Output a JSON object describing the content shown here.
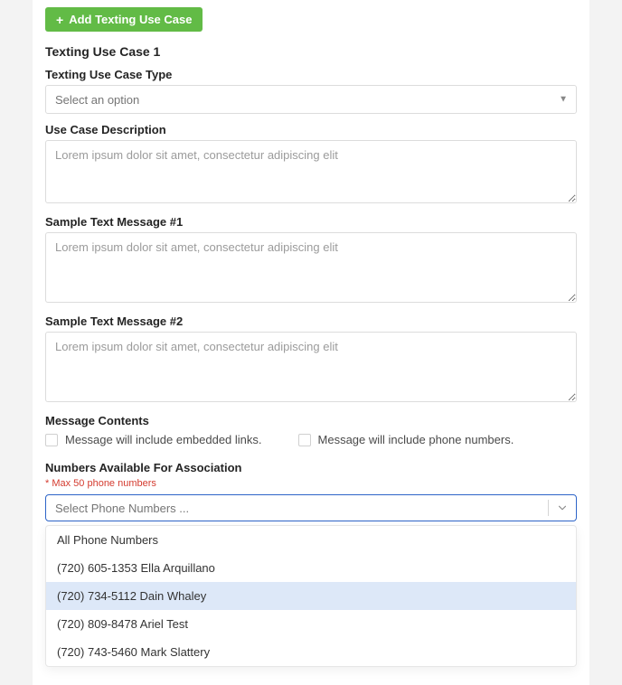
{
  "addButton": {
    "label": "Add Texting Use Case"
  },
  "heading": "Texting Use Case 1",
  "fields": {
    "typeLabel": "Texting Use Case Type",
    "typePlaceholder": "Select an option",
    "descLabel": "Use Case Description",
    "descPlaceholder": "Lorem ipsum dolor sit amet, consectetur adipiscing elit",
    "sample1Label": "Sample Text Message #1",
    "sample1Placeholder": "Lorem ipsum dolor sit amet, consectetur adipiscing elit",
    "sample2Label": "Sample Text Message #2",
    "sample2Placeholder": "Lorem ipsum dolor sit amet, consectetur adipiscing elit"
  },
  "messageContents": {
    "heading": "Message Contents",
    "opt1": "Message will include embedded links.",
    "opt2": "Message will include phone numbers."
  },
  "assoc": {
    "heading": "Numbers Available For Association",
    "note": "* Max 50 phone numbers",
    "placeholder": "Select Phone Numbers ..."
  },
  "phoneOptions": [
    "All Phone Numbers",
    "(720) 605-1353 Ella Arquillano",
    "(720) 734-5112 Dain Whaley",
    "(720) 809-8478 Ariel Test",
    "(720) 743-5460 Mark Slattery"
  ],
  "highlightedIndex": 2
}
